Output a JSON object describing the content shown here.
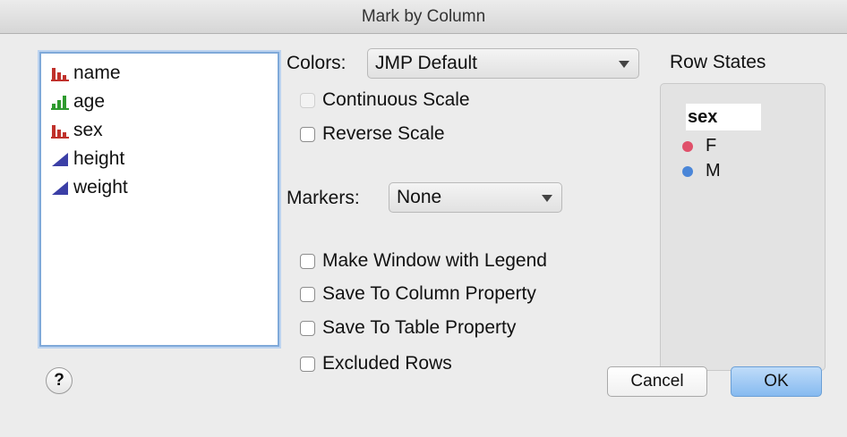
{
  "window": {
    "title": "Mark by Column"
  },
  "columns": [
    {
      "label": "name",
      "icon": "nominal-icon",
      "color": "#c0312b"
    },
    {
      "label": "age",
      "icon": "ordinal-icon",
      "color": "#2e9a2e"
    },
    {
      "label": "sex",
      "icon": "nominal-icon",
      "color": "#c0312b",
      "selected": true
    },
    {
      "label": "height",
      "icon": "continuous-icon",
      "color": "#3b3fa6"
    },
    {
      "label": "weight",
      "icon": "continuous-icon",
      "color": "#3b3fa6"
    }
  ],
  "colors": {
    "label": "Colors:",
    "value": "JMP Default"
  },
  "continuous_scale": {
    "label": "Continuous Scale",
    "checked": false,
    "disabled": true
  },
  "reverse_scale": {
    "label": "Reverse Scale",
    "checked": false
  },
  "markers": {
    "label": "Markers:",
    "value": "None"
  },
  "options": {
    "legend": "Make Window with Legend",
    "column_property": "Save To Column Property",
    "table_property": "Save To Table Property",
    "excluded_rows": "Excluded Rows"
  },
  "row_states": {
    "title": "Row States",
    "header": "sex",
    "items": [
      {
        "label": "F",
        "color": "#e0506a"
      },
      {
        "label": "M",
        "color": "#4a86d8"
      }
    ]
  },
  "buttons": {
    "help": "?",
    "cancel": "Cancel",
    "ok": "OK"
  }
}
